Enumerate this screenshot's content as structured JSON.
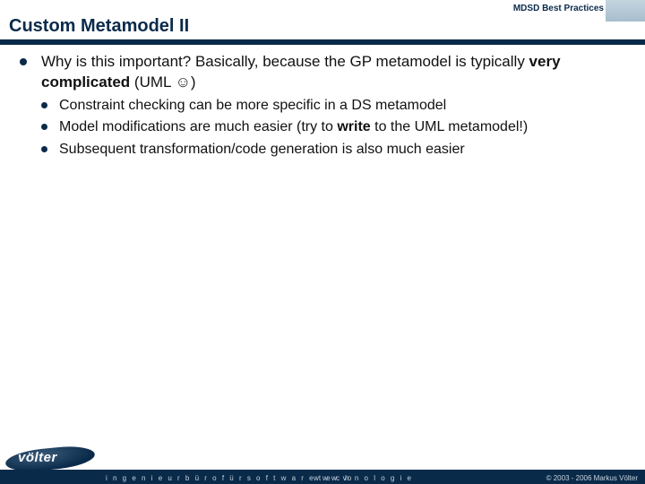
{
  "header": {
    "tag": "MDSD Best Practices"
  },
  "title": "Custom Metamodel II",
  "bullets": {
    "main": {
      "pre": "Why is this important? Basically, because the GP metamodel is typically ",
      "bold": "very complicated",
      "post": " (UML ☺)"
    },
    "subs": [
      {
        "text": "Constraint checking can be more specific in a DS metamodel"
      },
      {
        "pre": "Model modifications are much easier (try to ",
        "bold": "write",
        "post": " to the UML metamodel!)"
      },
      {
        "text": "Subsequent transformation/code generation is also much easier"
      }
    ]
  },
  "footer": {
    "logo_text": "völter",
    "tagline": "i n g e n i e u r b ü r o   f ü r   s o f t w a r e t e c h n o l o g i e",
    "url": "w w w. vo",
    "copyright": "© 2003 - 2006 Markus Völter"
  }
}
